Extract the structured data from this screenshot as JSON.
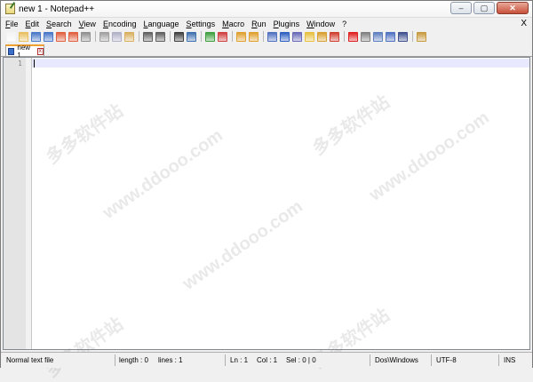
{
  "window": {
    "title": "new 1 - Notepad++",
    "buttons": [
      "–",
      "▢",
      "✕"
    ]
  },
  "menu": {
    "items": [
      "File",
      "Edit",
      "Search",
      "View",
      "Encoding",
      "Language",
      "Settings",
      "Macro",
      "Run",
      "Plugins",
      "Window",
      "?"
    ],
    "close_label": "X"
  },
  "toolbar": {
    "icons": [
      {
        "name": "new-file-icon",
        "color": "#f4f4f4"
      },
      {
        "name": "open-file-icon",
        "color": "#e8c060"
      },
      {
        "name": "save-icon",
        "color": "#4a78c8"
      },
      {
        "name": "save-all-icon",
        "color": "#4a78c8"
      },
      {
        "name": "close-icon",
        "color": "#e06040"
      },
      {
        "name": "close-all-icon",
        "color": "#e06040"
      },
      {
        "name": "print-icon",
        "color": "#909090"
      },
      {
        "sep": true
      },
      {
        "name": "cut-icon",
        "color": "#a0a0a0"
      },
      {
        "name": "copy-icon",
        "color": "#b0b0c8"
      },
      {
        "name": "paste-icon",
        "color": "#d8b060"
      },
      {
        "sep": true
      },
      {
        "name": "undo-icon",
        "color": "#606060"
      },
      {
        "name": "redo-icon",
        "color": "#606060"
      },
      {
        "sep": true
      },
      {
        "name": "find-icon",
        "color": "#404040"
      },
      {
        "name": "replace-icon",
        "color": "#4070b0"
      },
      {
        "sep": true
      },
      {
        "name": "zoom-in-icon",
        "color": "#40a040"
      },
      {
        "name": "zoom-out-icon",
        "color": "#d04040"
      },
      {
        "sep": true
      },
      {
        "name": "sync-vertical-icon",
        "color": "#e0a030"
      },
      {
        "name": "sync-horizontal-icon",
        "color": "#e0a030"
      },
      {
        "sep": true
      },
      {
        "name": "word-wrap-icon",
        "color": "#5070c0"
      },
      {
        "name": "show-all-chars-icon",
        "color": "#3060c0"
      },
      {
        "name": "indent-guide-icon",
        "color": "#6a6ab8"
      },
      {
        "name": "doc-map-icon",
        "color": "#e8c040"
      },
      {
        "name": "function-list-icon",
        "color": "#d8a030"
      },
      {
        "name": "folder-workspace-icon",
        "color": "#d04030"
      },
      {
        "sep": true
      },
      {
        "name": "record-macro-icon",
        "color": "#e02020"
      },
      {
        "name": "stop-record-icon",
        "color": "#808080"
      },
      {
        "name": "play-macro-icon",
        "color": "#6080c0"
      },
      {
        "name": "run-macro-multiple-icon",
        "color": "#5070c0"
      },
      {
        "name": "save-macro-icon",
        "color": "#405090"
      },
      {
        "sep": true
      },
      {
        "name": "plugin-icon",
        "color": "#c89a40"
      }
    ]
  },
  "tabs": [
    {
      "label": "new 1",
      "close": "x"
    }
  ],
  "editor": {
    "line_numbers": [
      "1"
    ]
  },
  "status": {
    "file_type": "Normal text file",
    "length": "length : 0",
    "lines": "lines : 1",
    "ln": "Ln : 1",
    "col": "Col : 1",
    "sel": "Sel : 0 | 0",
    "eol": "Dos\\Windows",
    "encoding": "UTF-8",
    "mode": "INS"
  },
  "watermarks": [
    "www.ddooo.com",
    "多多软件站"
  ]
}
